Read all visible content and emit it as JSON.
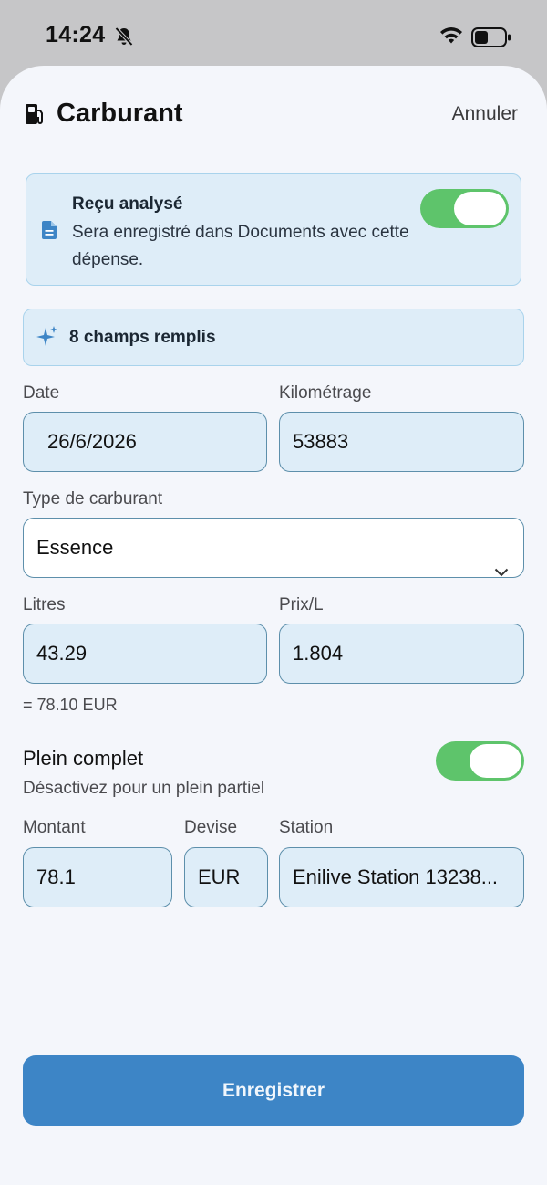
{
  "status_bar": {
    "time": "14:24",
    "icons": [
      "bell-slash-icon",
      "wifi-icon",
      "battery-icon"
    ]
  },
  "header": {
    "title": "Carburant",
    "icon": "fuel-pump-icon",
    "cancel_label": "Annuler"
  },
  "receipt": {
    "title": "Reçu analysé",
    "description": "Sera enregistré dans Documents avec cette dépense.",
    "icon": "document-icon",
    "toggle_on": true
  },
  "autofill": {
    "text": "8 champs remplis",
    "icon": "sparkle-icon"
  },
  "form": {
    "date": {
      "label": "Date",
      "value": "26/6/2026"
    },
    "mileage": {
      "label": "Kilométrage",
      "value": "53883"
    },
    "fuel_type": {
      "label": "Type de carburant",
      "value": "Essence"
    },
    "liters": {
      "label": "Litres",
      "value": "43.29"
    },
    "price_per_liter": {
      "label": "Prix/L",
      "value": "1.804"
    },
    "computed_total": "= 78.10 EUR",
    "full_tank": {
      "label": "Plein complet",
      "description": "Désactivez pour un plein partiel",
      "toggle_on": true
    },
    "amount": {
      "label": "Montant",
      "value": "78.1"
    },
    "currency": {
      "label": "Devise",
      "value": "EUR"
    },
    "station": {
      "label": "Station",
      "value": "Enilive Station 13238..."
    }
  },
  "save_label": "Enregistrer",
  "colors": {
    "accent": "#3d85c6",
    "toggle_green": "#5ec46b",
    "field_fill": "#deedf8",
    "field_border": "#5d8fab"
  }
}
